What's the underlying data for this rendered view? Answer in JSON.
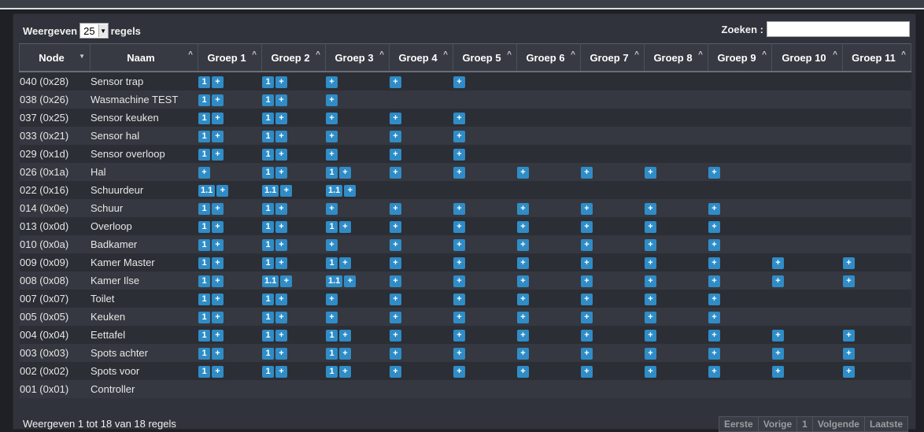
{
  "controls": {
    "show_prefix": "Weergeven",
    "page_size": "25",
    "show_suffix": "regels",
    "search_label": "Zoeken :",
    "search_value": ""
  },
  "columns": [
    "Node",
    "Naam",
    "Groep 1",
    "Groep 2",
    "Groep 3",
    "Groep 4",
    "Groep 5",
    "Groep 6",
    "Groep 7",
    "Groep 8",
    "Groep 9",
    "Groep 10",
    "Groep 11"
  ],
  "rows": [
    {
      "node": "040 (0x28)",
      "naam": "Sensor trap",
      "groups": [
        [
          "1",
          "+"
        ],
        [
          "1",
          "+"
        ],
        [
          "+"
        ],
        [
          "+"
        ],
        [
          "+"
        ],
        [],
        [],
        [],
        [],
        [],
        []
      ]
    },
    {
      "node": "038 (0x26)",
      "naam": "Wasmachine TEST",
      "groups": [
        [
          "1",
          "+"
        ],
        [
          "1",
          "+"
        ],
        [
          "+"
        ],
        [],
        [],
        [],
        [],
        [],
        [],
        [],
        []
      ]
    },
    {
      "node": "037 (0x25)",
      "naam": "Sensor keuken",
      "groups": [
        [
          "1",
          "+"
        ],
        [
          "1",
          "+"
        ],
        [
          "+"
        ],
        [
          "+"
        ],
        [
          "+"
        ],
        [],
        [],
        [],
        [],
        [],
        []
      ]
    },
    {
      "node": "033 (0x21)",
      "naam": "Sensor hal",
      "groups": [
        [
          "1",
          "+"
        ],
        [
          "1",
          "+"
        ],
        [
          "+"
        ],
        [
          "+"
        ],
        [
          "+"
        ],
        [],
        [],
        [],
        [],
        [],
        []
      ]
    },
    {
      "node": "029 (0x1d)",
      "naam": "Sensor overloop",
      "groups": [
        [
          "1",
          "+"
        ],
        [
          "1",
          "+"
        ],
        [
          "+"
        ],
        [
          "+"
        ],
        [
          "+"
        ],
        [],
        [],
        [],
        [],
        [],
        []
      ]
    },
    {
      "node": "026 (0x1a)",
      "naam": "Hal",
      "groups": [
        [
          "+"
        ],
        [
          "1",
          "+"
        ],
        [
          "1",
          "+"
        ],
        [
          "+"
        ],
        [
          "+"
        ],
        [
          "+"
        ],
        [
          "+"
        ],
        [
          "+"
        ],
        [
          "+"
        ],
        [],
        []
      ]
    },
    {
      "node": "022 (0x16)",
      "naam": "Schuurdeur",
      "groups": [
        [
          "1.1",
          "+"
        ],
        [
          "1.1",
          "+"
        ],
        [
          "1.1",
          "+"
        ],
        [],
        [],
        [],
        [],
        [],
        [],
        [],
        []
      ]
    },
    {
      "node": "014 (0x0e)",
      "naam": "Schuur",
      "groups": [
        [
          "1",
          "+"
        ],
        [
          "1",
          "+"
        ],
        [
          "+"
        ],
        [
          "+"
        ],
        [
          "+"
        ],
        [
          "+"
        ],
        [
          "+"
        ],
        [
          "+"
        ],
        [
          "+"
        ],
        [],
        []
      ]
    },
    {
      "node": "013 (0x0d)",
      "naam": "Overloop",
      "groups": [
        [
          "1",
          "+"
        ],
        [
          "1",
          "+"
        ],
        [
          "1",
          "+"
        ],
        [
          "+"
        ],
        [
          "+"
        ],
        [
          "+"
        ],
        [
          "+"
        ],
        [
          "+"
        ],
        [
          "+"
        ],
        [],
        []
      ]
    },
    {
      "node": "010 (0x0a)",
      "naam": "Badkamer",
      "groups": [
        [
          "1",
          "+"
        ],
        [
          "1",
          "+"
        ],
        [
          "+"
        ],
        [
          "+"
        ],
        [
          "+"
        ],
        [
          "+"
        ],
        [
          "+"
        ],
        [
          "+"
        ],
        [
          "+"
        ],
        [],
        []
      ]
    },
    {
      "node": "009 (0x09)",
      "naam": "Kamer Master",
      "groups": [
        [
          "1",
          "+"
        ],
        [
          "1",
          "+"
        ],
        [
          "1",
          "+"
        ],
        [
          "+"
        ],
        [
          "+"
        ],
        [
          "+"
        ],
        [
          "+"
        ],
        [
          "+"
        ],
        [
          "+"
        ],
        [
          "+"
        ],
        [
          "+"
        ]
      ]
    },
    {
      "node": "008 (0x08)",
      "naam": "Kamer Ilse",
      "groups": [
        [
          "1",
          "+"
        ],
        [
          "1.1",
          "+"
        ],
        [
          "1.1",
          "+"
        ],
        [
          "+"
        ],
        [
          "+"
        ],
        [
          "+"
        ],
        [
          "+"
        ],
        [
          "+"
        ],
        [
          "+"
        ],
        [
          "+"
        ],
        [
          "+"
        ]
      ]
    },
    {
      "node": "007 (0x07)",
      "naam": "Toilet",
      "groups": [
        [
          "1",
          "+"
        ],
        [
          "1",
          "+"
        ],
        [
          "+"
        ],
        [
          "+"
        ],
        [
          "+"
        ],
        [
          "+"
        ],
        [
          "+"
        ],
        [
          "+"
        ],
        [
          "+"
        ],
        [],
        []
      ]
    },
    {
      "node": "005 (0x05)",
      "naam": "Keuken",
      "groups": [
        [
          "1",
          "+"
        ],
        [
          "1",
          "+"
        ],
        [
          "+"
        ],
        [
          "+"
        ],
        [
          "+"
        ],
        [
          "+"
        ],
        [
          "+"
        ],
        [
          "+"
        ],
        [
          "+"
        ],
        [],
        []
      ]
    },
    {
      "node": "004 (0x04)",
      "naam": "Eettafel",
      "groups": [
        [
          "1",
          "+"
        ],
        [
          "1",
          "+"
        ],
        [
          "1",
          "+"
        ],
        [
          "+"
        ],
        [
          "+"
        ],
        [
          "+"
        ],
        [
          "+"
        ],
        [
          "+"
        ],
        [
          "+"
        ],
        [
          "+"
        ],
        [
          "+"
        ]
      ]
    },
    {
      "node": "003 (0x03)",
      "naam": "Spots achter",
      "groups": [
        [
          "1",
          "+"
        ],
        [
          "1",
          "+"
        ],
        [
          "1",
          "+"
        ],
        [
          "+"
        ],
        [
          "+"
        ],
        [
          "+"
        ],
        [
          "+"
        ],
        [
          "+"
        ],
        [
          "+"
        ],
        [
          "+"
        ],
        [
          "+"
        ]
      ]
    },
    {
      "node": "002 (0x02)",
      "naam": "Spots voor",
      "groups": [
        [
          "1",
          "+"
        ],
        [
          "1",
          "+"
        ],
        [
          "1",
          "+"
        ],
        [
          "+"
        ],
        [
          "+"
        ],
        [
          "+"
        ],
        [
          "+"
        ],
        [
          "+"
        ],
        [
          "+"
        ],
        [
          "+"
        ],
        [
          "+"
        ]
      ]
    },
    {
      "node": "001 (0x01)",
      "naam": "Controller",
      "groups": [
        [],
        [],
        [],
        [],
        [],
        [],
        [],
        [],
        [],
        [],
        []
      ]
    }
  ],
  "footer": {
    "info": "Weergeven 1 tot 18 van 18 regels",
    "pager": [
      "Eerste",
      "Vorige",
      "1",
      "Volgende",
      "Laatste"
    ]
  }
}
